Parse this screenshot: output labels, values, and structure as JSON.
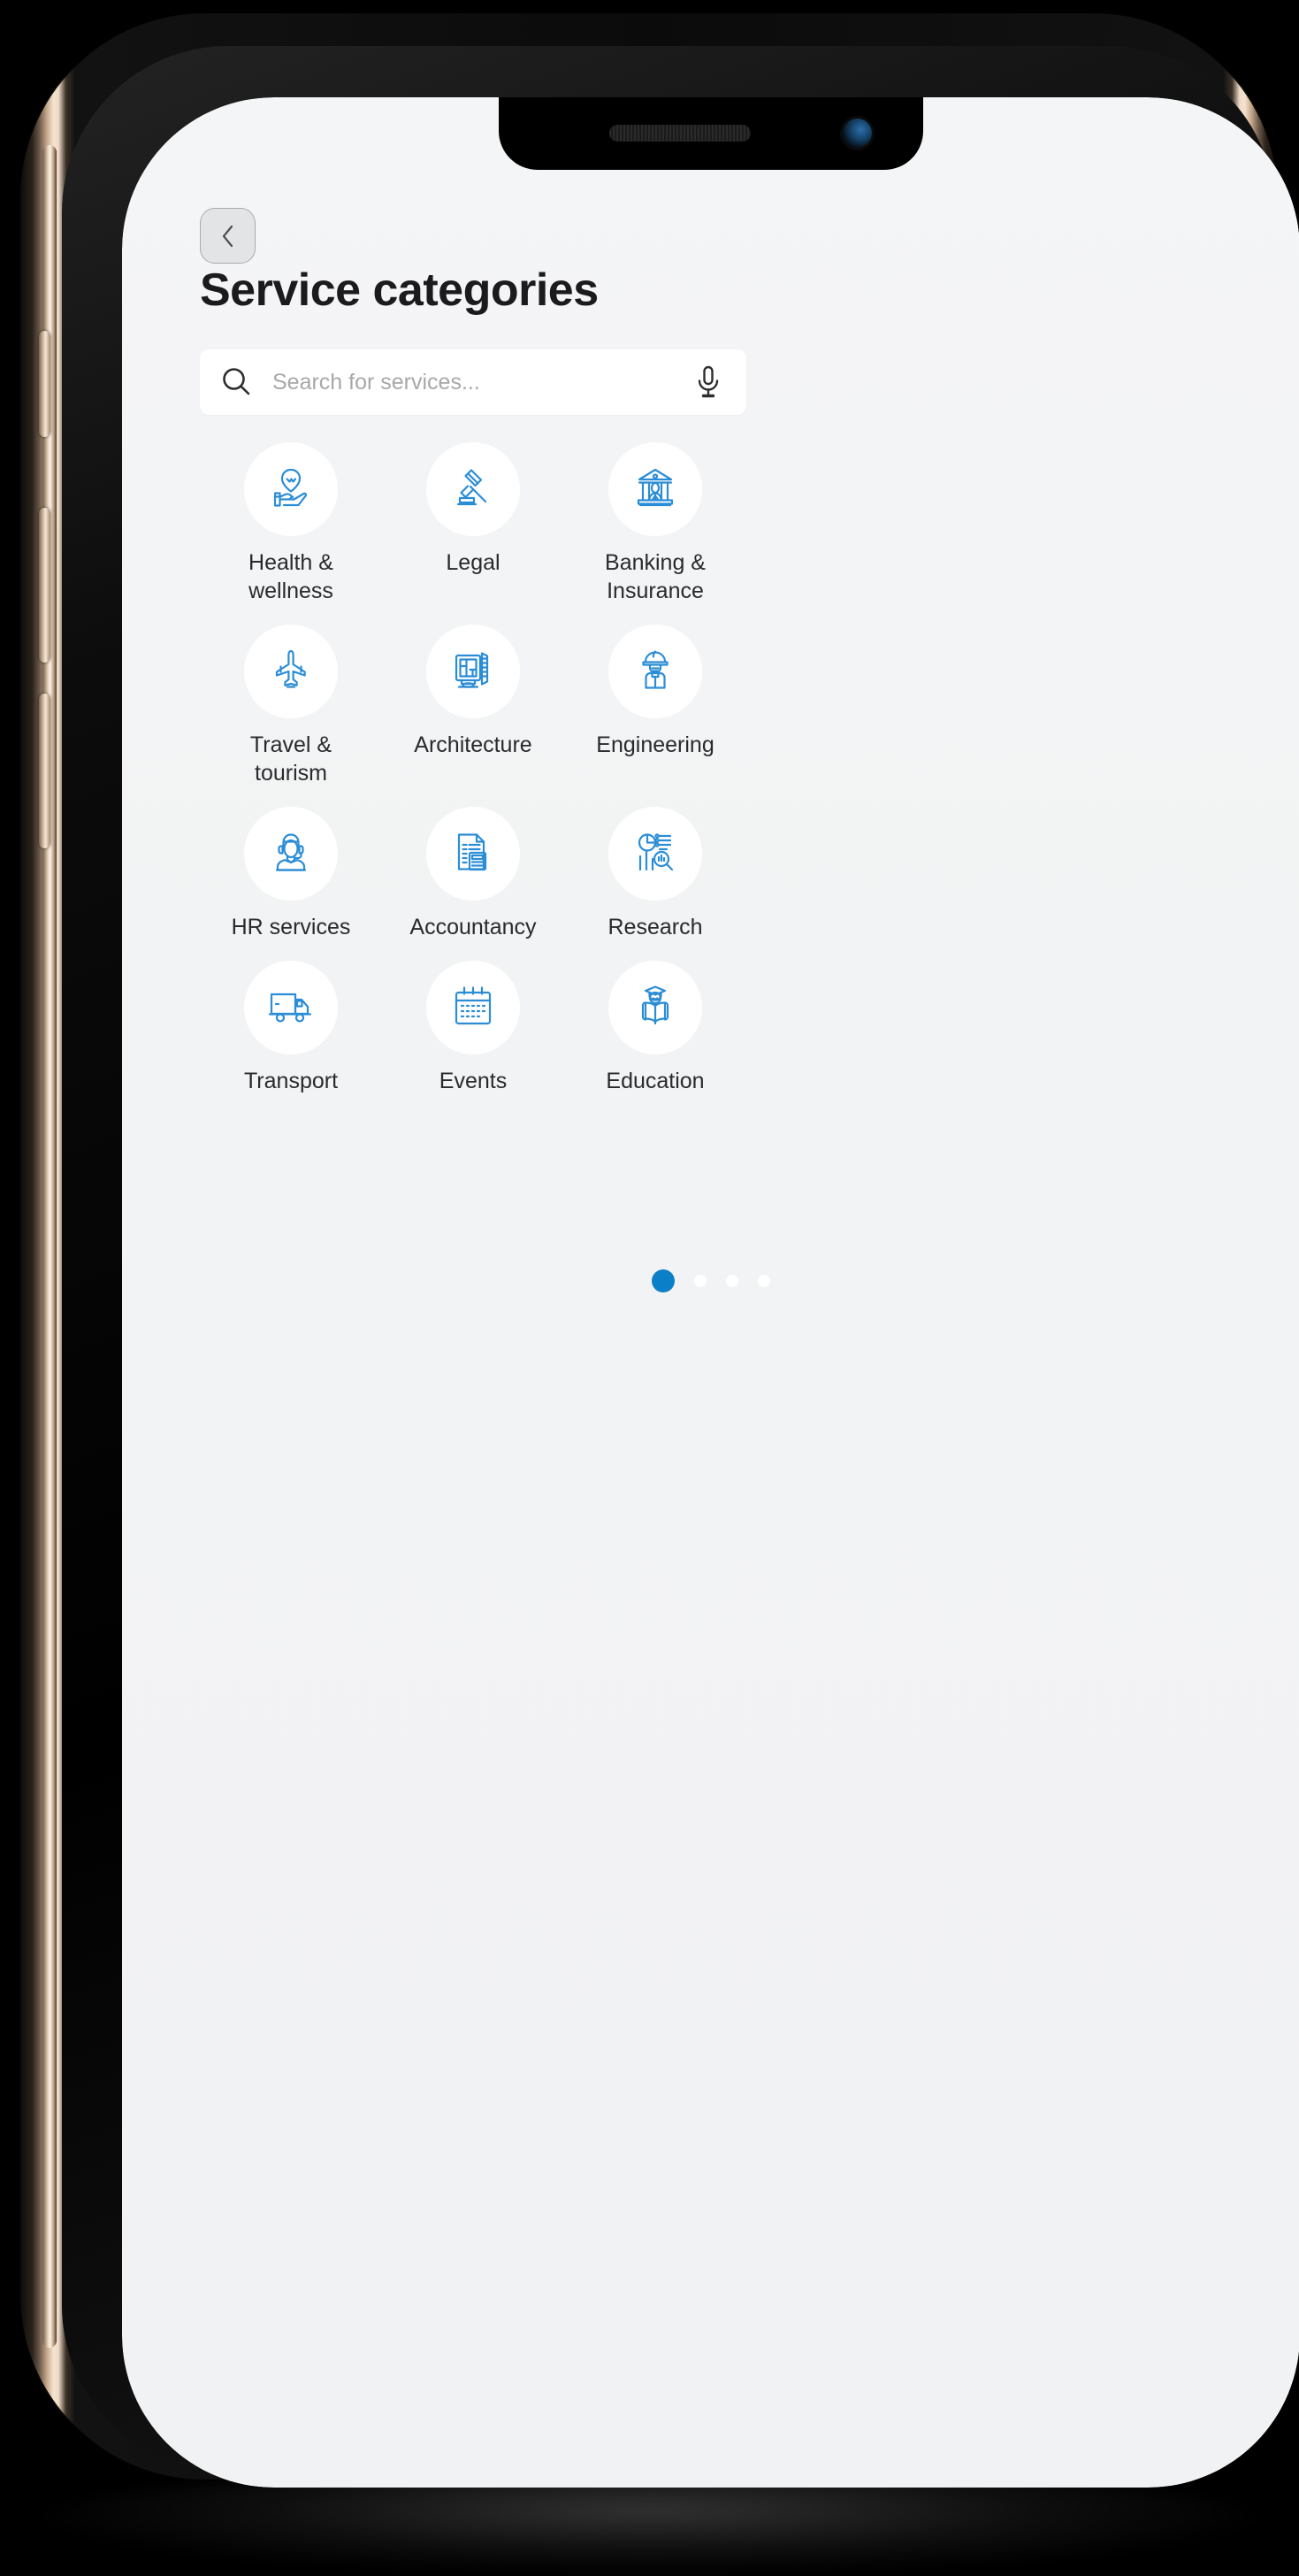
{
  "device": {
    "frame_color": "#f4e3d1",
    "bezel_color": "#0b0b0b",
    "buttons": {
      "mute_switch": "mute-switch",
      "volume_up": "volume-up-button",
      "volume_down": "volume-down-button",
      "power": "power-button"
    },
    "notch": {
      "speaker": "earpiece-speaker",
      "camera": "front-camera"
    }
  },
  "screen": {
    "background": "#f2f3f4",
    "accent_color": "#2b8dd6",
    "active_dot_color": "#0b7fc7"
  },
  "header": {
    "back_icon": "chevron-left-icon",
    "title": "Service categories"
  },
  "search": {
    "icon": "search-icon",
    "value": "",
    "placeholder": "Search for services...",
    "mic_icon": "microphone-icon"
  },
  "categories": [
    {
      "label": "Health & wellness",
      "icon": "hand-holding-heart-icon"
    },
    {
      "label": "Legal",
      "icon": "gavel-icon"
    },
    {
      "label": "Banking & Insurance",
      "icon": "bank-building-icon"
    },
    {
      "label": "Travel & tourism",
      "icon": "airplane-icon"
    },
    {
      "label": "Architecture",
      "icon": "blueprint-monitor-icon"
    },
    {
      "label": "Engineering",
      "icon": "engineer-hardhat-icon"
    },
    {
      "label": "HR services",
      "icon": "support-agent-headset-icon"
    },
    {
      "label": "Accountancy",
      "icon": "document-calculator-icon"
    },
    {
      "label": "Research",
      "icon": "chart-magnifier-icon"
    },
    {
      "label": "Transport",
      "icon": "delivery-truck-icon"
    },
    {
      "label": "Events",
      "icon": "calendar-icon"
    },
    {
      "label": "Education",
      "icon": "graduate-reading-icon"
    }
  ],
  "pagination": {
    "total": 4,
    "active_index": 0
  }
}
